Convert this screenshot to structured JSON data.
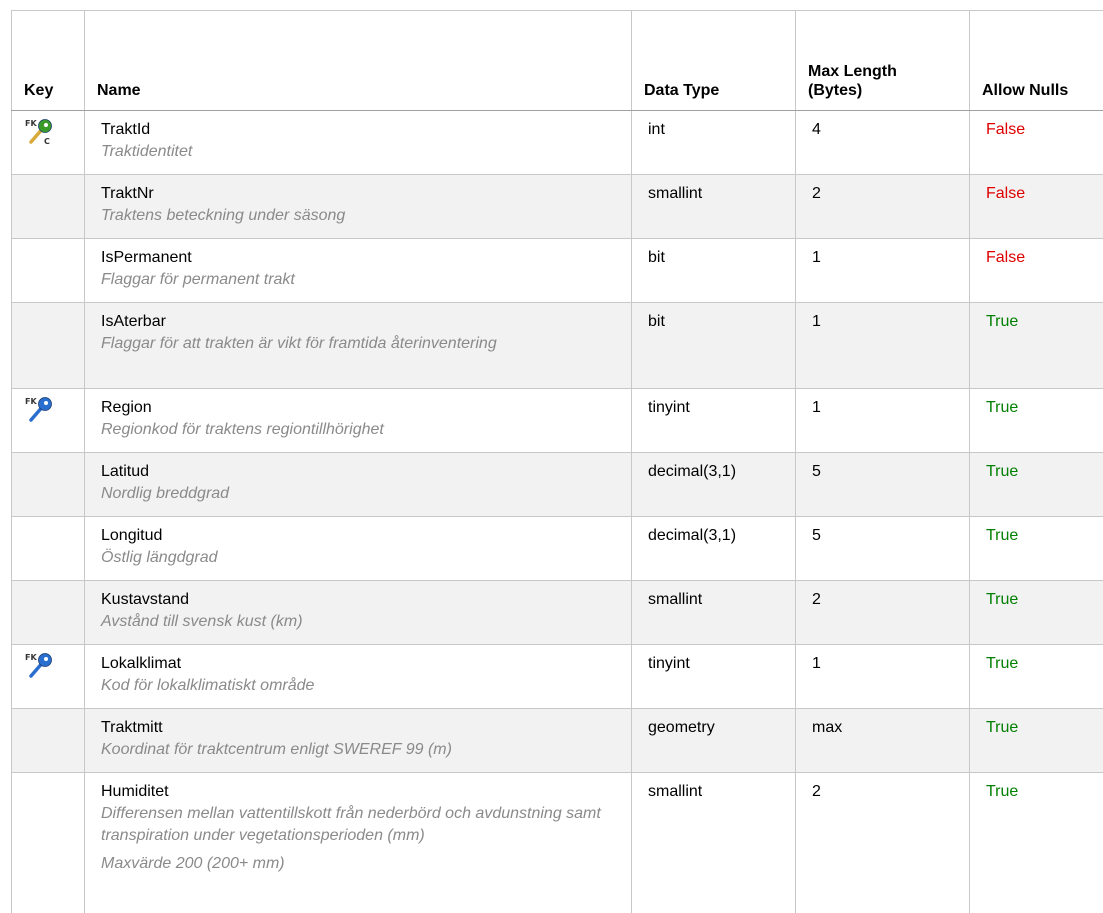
{
  "headers": {
    "key": "Key",
    "name": "Name",
    "data_type": "Data Type",
    "max_length_line1": "Max Length",
    "max_length_line2": "(Bytes)",
    "allow_nulls": "Allow Nulls"
  },
  "rows": [
    {
      "key": "pk-fk-key-icon",
      "name": "TraktId",
      "desc": "Traktidentitet",
      "type": "int",
      "len": "4",
      "nulls": "False"
    },
    {
      "key": "",
      "name": "TraktNr",
      "desc": "Traktens beteckning under säsong",
      "type": "smallint",
      "len": "2",
      "nulls": "False"
    },
    {
      "key": "",
      "name": "IsPermanent",
      "desc": "Flaggar för permanent trakt",
      "type": "bit",
      "len": "1",
      "nulls": "False"
    },
    {
      "key": "",
      "name": "IsAterbar",
      "desc": "Flaggar för att trakten är vikt för framtida återinventering",
      "type": "bit",
      "len": "1",
      "nulls": "True"
    },
    {
      "key": "fk-key-icon",
      "name": "Region",
      "desc": "Regionkod för traktens regiontillhörighet",
      "type": "tinyint",
      "len": "1",
      "nulls": "True"
    },
    {
      "key": "",
      "name": "Latitud",
      "desc": "Nordlig breddgrad",
      "type": "decimal(3,1)",
      "len": "5",
      "nulls": "True"
    },
    {
      "key": "",
      "name": "Longitud",
      "desc": "Östlig längdgrad",
      "type": "decimal(3,1)",
      "len": "5",
      "nulls": "True"
    },
    {
      "key": "",
      "name": "Kustavstand",
      "desc": "Avstånd till svensk kust (km)",
      "type": "smallint",
      "len": "2",
      "nulls": "True"
    },
    {
      "key": "fk-key-icon",
      "name": "Lokalklimat",
      "desc": "Kod för lokalklimatiskt område",
      "type": "tinyint",
      "len": "1",
      "nulls": "True"
    },
    {
      "key": "",
      "name": "Traktmitt",
      "desc": "Koordinat för traktcentrum enligt SWEREF 99 (m)",
      "type": "geometry",
      "len": "max",
      "nulls": "True"
    },
    {
      "key": "",
      "name": "Humiditet",
      "desc": "Differensen mellan vattentillskott från nederbörd och avdunstning samt transpiration under vegetationsperioden (mm)",
      "note": "Maxvärde 200 (200+ mm)",
      "type": "smallint",
      "len": "2",
      "nulls": "True"
    }
  ],
  "colors": {
    "false": "#e00000",
    "true": "#008000",
    "key_green": "#3a9a2a",
    "key_blue": "#2a6fd0",
    "key_gold": "#d9a93a"
  }
}
